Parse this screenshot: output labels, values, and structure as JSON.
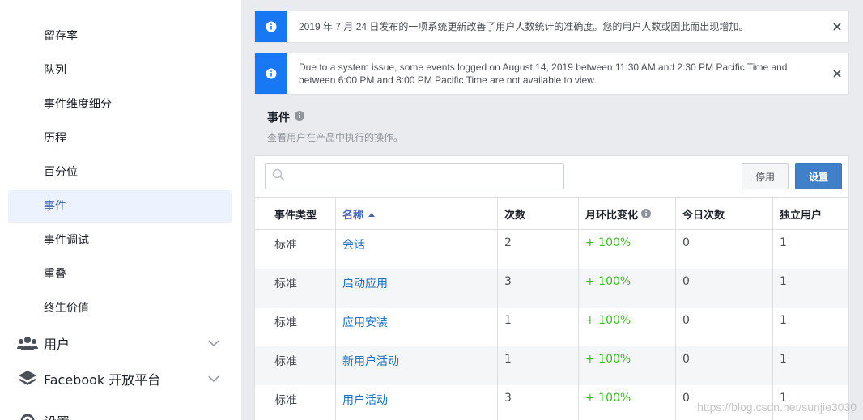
{
  "sidebar": {
    "items": [
      {
        "label": "留存率"
      },
      {
        "label": "队列"
      },
      {
        "label": "事件维度细分"
      },
      {
        "label": "历程"
      },
      {
        "label": "百分位"
      },
      {
        "label": "事件"
      },
      {
        "label": "事件调试"
      },
      {
        "label": "重叠"
      },
      {
        "label": "终生价值"
      }
    ],
    "sections": [
      {
        "label": "用户",
        "icon": "users-icon"
      },
      {
        "label": "Facebook 开放平台",
        "icon": "layers-icon"
      },
      {
        "label": "设置",
        "icon": "gear-icon"
      }
    ],
    "active_color": "#4267b2"
  },
  "notices": [
    {
      "text": "2019 年 7 月 24 日发布的一项系统更新改善了用户人数统计的准确度。您的用户人数或因此而出现增加。"
    },
    {
      "text": "Due to a system issue, some events logged on August 14, 2019 between 11:30 AM and 2:30 PM Pacific Time and between 6:00 PM and 8:00 PM Pacific Time are not available to view."
    }
  ],
  "events": {
    "title": "事件",
    "subtitle": "查看用户在产品中执行的操作。",
    "search_placeholder": "",
    "disable_label": "停用",
    "settings_label": "设置",
    "columns": [
      "事件类型",
      "名称",
      "次数",
      "月环比变化",
      "今日次数",
      "独立用户"
    ],
    "rows": [
      {
        "type": "标准",
        "name": "会话",
        "count": "2",
        "mom": "+ 100%",
        "today": "0",
        "unique": "1"
      },
      {
        "type": "标准",
        "name": "启动应用",
        "count": "3",
        "mom": "+ 100%",
        "today": "0",
        "unique": "1"
      },
      {
        "type": "标准",
        "name": "应用安装",
        "count": "1",
        "mom": "+ 100%",
        "today": "0",
        "unique": "1"
      },
      {
        "type": "标准",
        "name": "新用户活动",
        "count": "1",
        "mom": "+ 100%",
        "today": "0",
        "unique": "1"
      },
      {
        "type": "标准",
        "name": "用户活动",
        "count": "3",
        "mom": "+ 100%",
        "today": "0",
        "unique": "1"
      }
    ]
  },
  "watermark": "https://blog.csdn.net/sunjie3030",
  "colors": {
    "accent": "#1877f2",
    "link": "#1a6fc2",
    "positive": "#42b72a",
    "button": "#4080c8"
  }
}
